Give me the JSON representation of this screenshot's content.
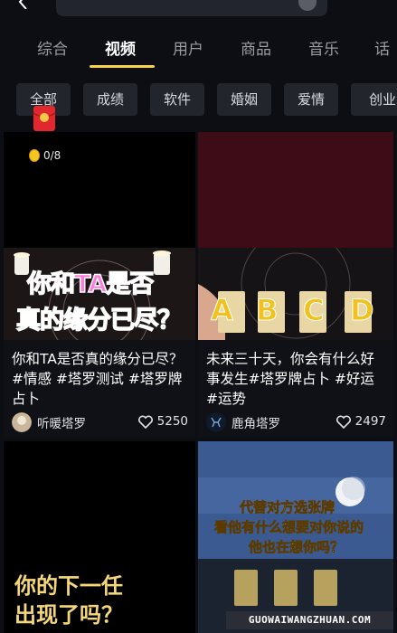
{
  "tabs": [
    {
      "label": "综合"
    },
    {
      "label": "视频"
    },
    {
      "label": "用户"
    },
    {
      "label": "商品"
    },
    {
      "label": "音乐"
    },
    {
      "label": "话"
    }
  ],
  "chips": [
    {
      "label": "全部"
    },
    {
      "label": "成绩"
    },
    {
      "label": "软件"
    },
    {
      "label": "婚姻"
    },
    {
      "label": "爱情"
    },
    {
      "label": "创业"
    }
  ],
  "coin_counter": "0/8",
  "cards": [
    {
      "overlay_text_line1": "你和TA是否",
      "overlay_text_line2": "真的缘分已尽？",
      "title": "你和TA是否真的缘分已尽？#情感 #塔罗测试 #塔罗牌占卜",
      "author": "听暖塔罗",
      "likes": "5250"
    },
    {
      "overlay_letters": [
        "A",
        "B",
        "C",
        "D"
      ],
      "title": "未来三十天，你会有什么好事发生#塔罗牌占卜 #好运 #运势",
      "author": "鹿角塔罗",
      "likes": "2497"
    },
    {
      "overlay_text_line1": "你的下一任",
      "overlay_text_line2": "出现了吗？"
    },
    {
      "overlay_text_line1": "代替对方选张牌",
      "overlay_text_line2": "看他有什么想要对你说的",
      "overlay_text_line3": "他也在想你吗？"
    }
  ],
  "watermark": "GUOWAIWANGZHUAN.COM",
  "colors": {
    "background": "#0d0e14",
    "accent": "#f7d24a",
    "chip_bg": "#23252d",
    "pink_text": "#ff5fc8"
  }
}
